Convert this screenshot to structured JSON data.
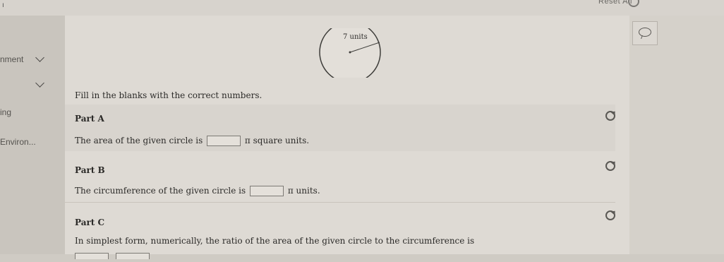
{
  "topbar": {
    "corner_mark": "ı",
    "reset_label": "Reset All"
  },
  "sidebar": {
    "items": [
      {
        "label": "nment"
      },
      {
        "label": "ing"
      },
      {
        "label": "Environ..."
      }
    ]
  },
  "diagram": {
    "radius_label": "7 units"
  },
  "instructions": "Fill in the blanks with the correct numbers.",
  "parts": [
    {
      "title": "Part A",
      "text_before": "The area of the given circle is",
      "text_after": "π square units."
    },
    {
      "title": "Part B",
      "text_before": "The circumference of the given circle is",
      "text_after": "π units."
    },
    {
      "title": "Part C",
      "text": "In simplest form, numerically, the ratio of the area of the given circle to the circumference is"
    }
  ]
}
